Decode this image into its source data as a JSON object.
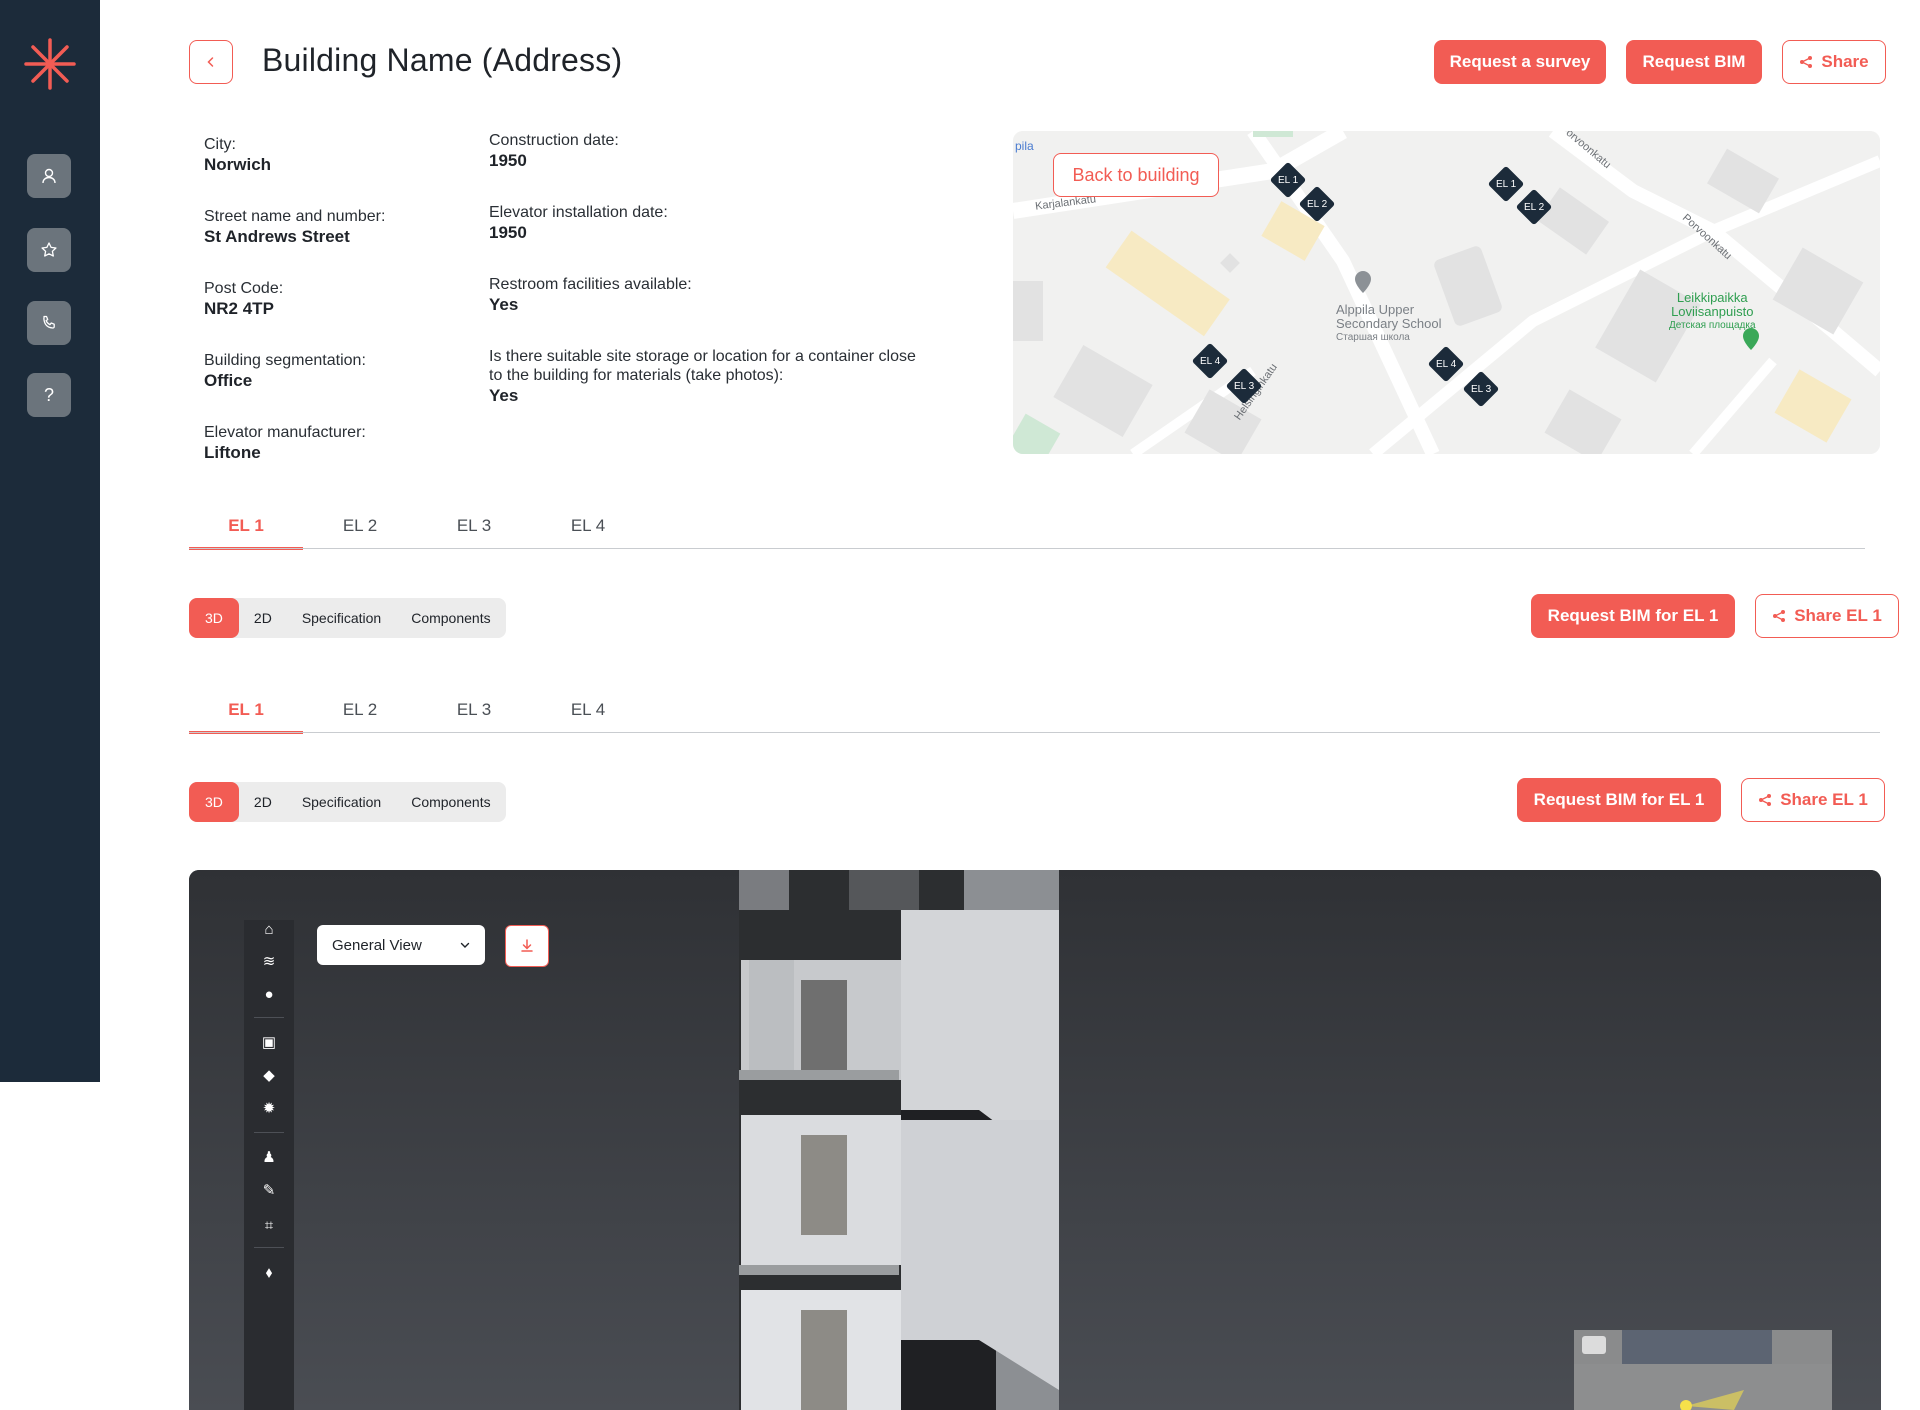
{
  "sidebar": {
    "logo": "asterisk-logo",
    "items": [
      {
        "icon": "user-icon"
      },
      {
        "icon": "star-icon"
      },
      {
        "icon": "phone-icon"
      },
      {
        "icon": "help-icon",
        "label": "?"
      }
    ]
  },
  "header": {
    "title": "Building Name (Address)",
    "request_survey": "Request a survey",
    "request_bim": "Request BIM",
    "share": "Share"
  },
  "info_left": [
    {
      "label": "City:",
      "value": "Norwich"
    },
    {
      "label": "Street name and number:",
      "value": "St Andrews Street"
    },
    {
      "label": "Post Code:",
      "value": "NR2 4TP"
    },
    {
      "label": "Building segmentation:",
      "value": "Office"
    },
    {
      "label": "Elevator manufacturer:",
      "value": "Liftone"
    }
  ],
  "info_right": [
    {
      "label": "Construction date:",
      "value": "1950"
    },
    {
      "label": "Elevator installation date:",
      "value": "1950"
    },
    {
      "label": "Restroom facilities available:",
      "value": "Yes"
    },
    {
      "label": "Is there suitable site storage or location for a container close to the building for materials (take photos):",
      "value": "Yes"
    }
  ],
  "map": {
    "back_button": "Back to building",
    "labels": {
      "pila": "pila",
      "karjalankatu": "Karjalankatu",
      "porvoonkatu": "Porvoonkatu",
      "orvoonkatu": "orvoonkatu",
      "school_1": "Alppila Upper",
      "school_2": "Secondary School",
      "school_ru": "Старшая школа",
      "park_1": "Leikkipaikka",
      "park_2": "Loviisanpuisto",
      "park_ru": "Детская площадка",
      "helsinginkatu": "Helsinginkatu"
    },
    "markers": [
      "EL 1",
      "EL 2",
      "EL 1",
      "EL 2",
      "EL 4",
      "EL 3",
      "EL 4",
      "EL 3"
    ]
  },
  "elevator_tabs_1": [
    "EL 1",
    "EL 2",
    "EL 3",
    "EL 4"
  ],
  "view_modes_1": [
    "3D",
    "2D",
    "Specification",
    "Components"
  ],
  "actions_1": {
    "request_bim": "Request BIM for EL 1",
    "share": "Share EL 1"
  },
  "elevator_tabs_2": [
    "EL 1",
    "EL 2",
    "EL 3",
    "EL 4"
  ],
  "view_modes_2": [
    "3D",
    "2D",
    "Specification",
    "Components"
  ],
  "actions_2": {
    "request_bim": "Request BIM for EL 1",
    "share": "Share EL 1"
  },
  "viewer": {
    "view_select": "General View",
    "tools": [
      "home-icon",
      "layers-icon",
      "sphere-icon",
      "screen-icon",
      "camera-icon",
      "settings-icon",
      "person-pin-icon",
      "ruler-icon",
      "crop-icon",
      "tag-icon"
    ]
  },
  "colors": {
    "accent": "#f25c54",
    "sidebar": "#1c2b3a",
    "viewer_bg": "#3a3d42"
  }
}
